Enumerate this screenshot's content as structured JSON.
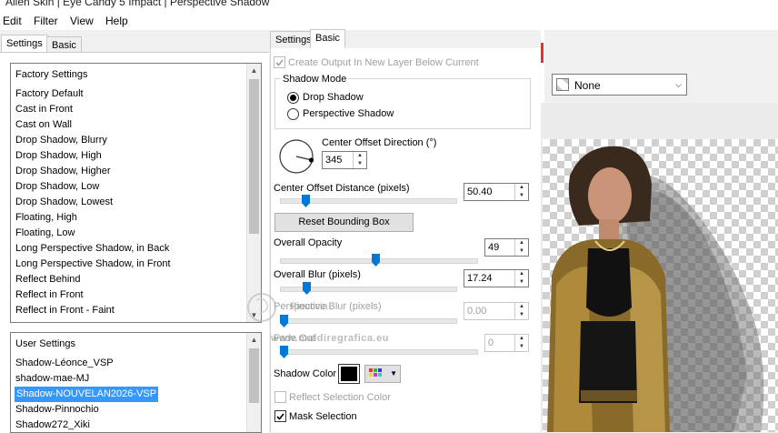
{
  "window": {
    "title": "Alien Skin | Eye Candy 5 Impact | Perspective Shadow"
  },
  "menu": [
    "Edit",
    "Filter",
    "View",
    "Help"
  ],
  "left_tabs": [
    "Settings",
    "Basic"
  ],
  "factory": {
    "header": "Factory Settings",
    "items": [
      "Factory Default",
      "Cast in Front",
      "Cast on Wall",
      "Drop Shadow, Blurry",
      "Drop Shadow, High",
      "Drop Shadow, Higher",
      "Drop Shadow, Low",
      "Drop Shadow, Lowest",
      "Floating, High",
      "Floating, Low",
      "Long Perspective Shadow, in Back",
      "Long Perspective Shadow, in Front",
      "Reflect Behind",
      "Reflect in Front",
      "Reflect in Front - Faint"
    ]
  },
  "user": {
    "header": "User Settings",
    "items": [
      "Shadow-Léonce_VSP",
      "shadow-mae-MJ",
      "Shadow-NOUVELAN2026-VSP",
      "Shadow-Pinnochio",
      "Shadow272_Xiki"
    ],
    "selected": "Shadow-NOUVELAN2026-VSP"
  },
  "mid_tabs": [
    "Settings",
    "Basic"
  ],
  "basic": {
    "create_output": "Create Output In New Layer Below Current",
    "shadow_mode_label": "Shadow Mode",
    "mode_drop": "Drop Shadow",
    "mode_persp": "Perspective Shadow",
    "direction_label": "Center Offset Direction (°)",
    "direction_value": "345",
    "distance_label": "Center Offset Distance (pixels)",
    "distance_value": "50.40",
    "reset_label": "Reset Bounding Box",
    "opacity_label": "Overall Opacity",
    "opacity_value": "49",
    "blur_label": "Overall Blur (pixels)",
    "blur_value": "17.24",
    "persp_blur_label": "Perspective Blur (pixels)",
    "persp_blur_value": "0.00",
    "fade_label": "Fade Out",
    "fade_value": "0",
    "shadow_color_label": "Shadow Color",
    "shadow_color": "#000000",
    "reflect_label": "Reflect Selection Color",
    "mask_label": "Mask Selection"
  },
  "preview": {
    "dropdown_value": "None"
  },
  "watermark": {
    "name": "Pinuccia",
    "site": "www.maldiregrafica.eu"
  }
}
